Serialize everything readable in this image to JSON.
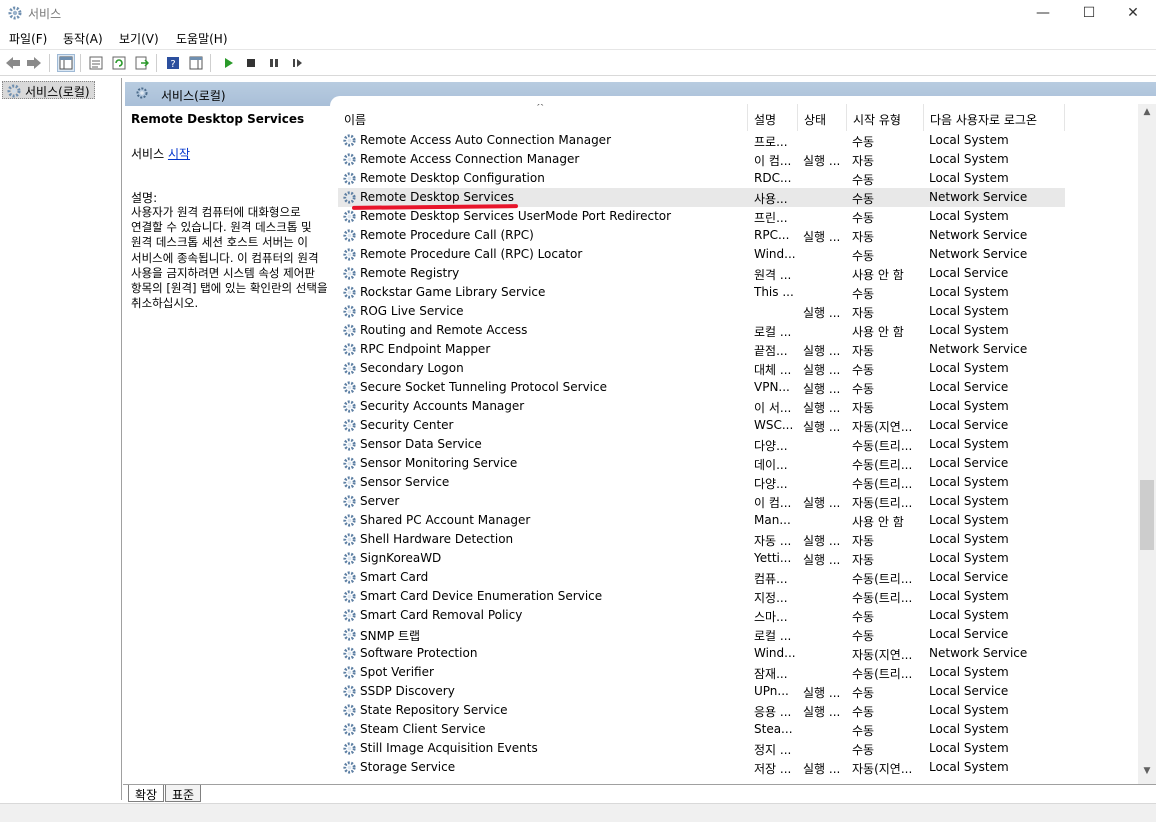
{
  "window": {
    "title": "서비스",
    "min_symbol": "—",
    "max_symbol": "☐",
    "close_symbol": "✕"
  },
  "menu": [
    "파일(F)",
    "동작(A)",
    "보기(V)",
    "도움말(H)"
  ],
  "tree": {
    "root_label": "서비스(로컬)"
  },
  "panel": {
    "header_label": "서비스(로컬)"
  },
  "details": {
    "service_title": "Remote Desktop Services",
    "action_prefix": "서비스 ",
    "action_link": "시작",
    "desc_label": "설명:",
    "desc_text": "사용자가 원격 컴퓨터에 대화형으로 연결할 수 있습니다. 원격 데스크톱 및 원격 데스크톱 세션 호스트 서버는 이 서비스에 종속됩니다. 이 컴퓨터의 원격 사용을 금지하려면 시스템 속성 제어판 항목의 [원격] 탭에 있는 확인란의 선택을 취소하십시오."
  },
  "columns": {
    "name": "이름",
    "desc": "설명",
    "status": "상태",
    "start": "시작 유형",
    "logon": "다음 사용자로 로그온"
  },
  "sort_indicator": "^",
  "selected_index": 3,
  "services": [
    {
      "name": "Remote Access Auto Connection Manager",
      "desc": "프로...",
      "status": "",
      "start": "수동",
      "logon": "Local System"
    },
    {
      "name": "Remote Access Connection Manager",
      "desc": "이 컴...",
      "status": "실행 ...",
      "start": "자동",
      "logon": "Local System"
    },
    {
      "name": "Remote Desktop Configuration",
      "desc": "RDC...",
      "status": "",
      "start": "수동",
      "logon": "Local System"
    },
    {
      "name": "Remote Desktop Services",
      "desc": "사용...",
      "status": "",
      "start": "수동",
      "logon": "Network Service"
    },
    {
      "name": "Remote Desktop Services UserMode Port Redirector",
      "desc": "프린...",
      "status": "",
      "start": "수동",
      "logon": "Local System"
    },
    {
      "name": "Remote Procedure Call (RPC)",
      "desc": "RPC...",
      "status": "실행 ...",
      "start": "자동",
      "logon": "Network Service"
    },
    {
      "name": "Remote Procedure Call (RPC) Locator",
      "desc": "Wind...",
      "status": "",
      "start": "수동",
      "logon": "Network Service"
    },
    {
      "name": "Remote Registry",
      "desc": "원격 ...",
      "status": "",
      "start": "사용 안 함",
      "logon": "Local Service"
    },
    {
      "name": "Rockstar Game Library Service",
      "desc": "This ...",
      "status": "",
      "start": "수동",
      "logon": "Local System"
    },
    {
      "name": "ROG Live Service",
      "desc": "",
      "status": "실행 ...",
      "start": "자동",
      "logon": "Local System"
    },
    {
      "name": "Routing and Remote Access",
      "desc": "로컬 ...",
      "status": "",
      "start": "사용 안 함",
      "logon": "Local System"
    },
    {
      "name": "RPC Endpoint Mapper",
      "desc": "끝점...",
      "status": "실행 ...",
      "start": "자동",
      "logon": "Network Service"
    },
    {
      "name": "Secondary Logon",
      "desc": "대체 ...",
      "status": "실행 ...",
      "start": "수동",
      "logon": "Local System"
    },
    {
      "name": "Secure Socket Tunneling Protocol Service",
      "desc": "VPN...",
      "status": "실행 ...",
      "start": "수동",
      "logon": "Local Service"
    },
    {
      "name": "Security Accounts Manager",
      "desc": "이 서...",
      "status": "실행 ...",
      "start": "자동",
      "logon": "Local System"
    },
    {
      "name": "Security Center",
      "desc": "WSC...",
      "status": "실행 ...",
      "start": "자동(지연...",
      "logon": "Local Service"
    },
    {
      "name": "Sensor Data Service",
      "desc": "다양...",
      "status": "",
      "start": "수동(트리...",
      "logon": "Local System"
    },
    {
      "name": "Sensor Monitoring Service",
      "desc": "데이...",
      "status": "",
      "start": "수동(트리...",
      "logon": "Local Service"
    },
    {
      "name": "Sensor Service",
      "desc": "다양...",
      "status": "",
      "start": "수동(트리...",
      "logon": "Local System"
    },
    {
      "name": "Server",
      "desc": "이 컴...",
      "status": "실행 ...",
      "start": "자동(트리...",
      "logon": "Local System"
    },
    {
      "name": "Shared PC Account Manager",
      "desc": "Man...",
      "status": "",
      "start": "사용 안 함",
      "logon": "Local System"
    },
    {
      "name": "Shell Hardware Detection",
      "desc": "자동 ...",
      "status": "실행 ...",
      "start": "자동",
      "logon": "Local System"
    },
    {
      "name": "SignKoreaWD",
      "desc": "Yetti...",
      "status": "실행 ...",
      "start": "자동",
      "logon": "Local System"
    },
    {
      "name": "Smart Card",
      "desc": "컴퓨...",
      "status": "",
      "start": "수동(트리...",
      "logon": "Local Service"
    },
    {
      "name": "Smart Card Device Enumeration Service",
      "desc": "지정...",
      "status": "",
      "start": "수동(트리...",
      "logon": "Local System"
    },
    {
      "name": "Smart Card Removal Policy",
      "desc": "스마...",
      "status": "",
      "start": "수동",
      "logon": "Local System"
    },
    {
      "name": "SNMP 트랩",
      "desc": "로컬 ...",
      "status": "",
      "start": "수동",
      "logon": "Local Service"
    },
    {
      "name": "Software Protection",
      "desc": "Wind...",
      "status": "",
      "start": "자동(지연...",
      "logon": "Network Service"
    },
    {
      "name": "Spot Verifier",
      "desc": "잠재...",
      "status": "",
      "start": "수동(트리...",
      "logon": "Local System"
    },
    {
      "name": "SSDP Discovery",
      "desc": "UPn...",
      "status": "실행 ...",
      "start": "수동",
      "logon": "Local Service"
    },
    {
      "name": "State Repository Service",
      "desc": "응용 ...",
      "status": "실행 ...",
      "start": "수동",
      "logon": "Local System"
    },
    {
      "name": "Steam Client Service",
      "desc": "Stea...",
      "status": "",
      "start": "수동",
      "logon": "Local System"
    },
    {
      "name": "Still Image Acquisition Events",
      "desc": "정지 ...",
      "status": "",
      "start": "수동",
      "logon": "Local System"
    },
    {
      "name": "Storage Service",
      "desc": "저장 ...",
      "status": "실행 ...",
      "start": "자동(지연...",
      "logon": "Local System"
    }
  ],
  "tabs": [
    "확장",
    "표준"
  ]
}
